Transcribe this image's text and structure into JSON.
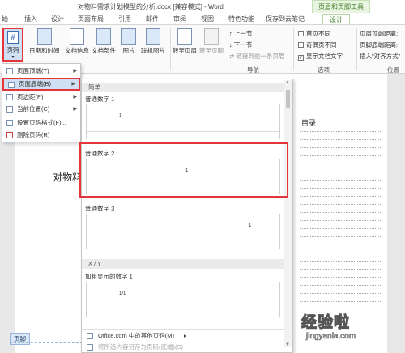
{
  "window": {
    "title": "对物料需求计划模型的分析.docx [兼容模式] - Word"
  },
  "contextual_tab_group": {
    "label": "页眉和页脚工具"
  },
  "tabs": [
    "始",
    "插入",
    "设计",
    "页面布局",
    "引用",
    "邮件",
    "审阅",
    "视图",
    "特色功能",
    "保存到云笔记",
    "设计"
  ],
  "ribbon": {
    "page_number": {
      "label": "页码",
      "icon": "#"
    },
    "buttons": [
      "日期和时间",
      "文档信息",
      "文档部件",
      "图片",
      "联机图片",
      "转至页眉",
      "转至页脚"
    ],
    "nav": {
      "prev": "上一节",
      "next": "下一节",
      "link_prev": "链接到前一条页眉",
      "group_label": "导航"
    },
    "options": {
      "first_page": "首页不同",
      "odd_even": "奇偶页不同",
      "show_text": "显示文档文字",
      "group_label": "选项"
    },
    "position": {
      "header_top": "页眉顶端距离:",
      "footer_bottom": "页脚底端距离:",
      "insert_align": "插入\"对齐方式\"",
      "group_label": "位置"
    }
  },
  "menu": {
    "items": [
      {
        "label": "页面顶端(T)",
        "has_sub": true
      },
      {
        "label": "页面底端(B)",
        "has_sub": true
      },
      {
        "label": "页边距(P)",
        "has_sub": true
      },
      {
        "label": "当前位置(C)",
        "has_sub": true
      },
      {
        "label": "设置页码格式(F)...",
        "has_sub": false
      },
      {
        "label": "删除页码(R)",
        "has_sub": false
      }
    ]
  },
  "gallery": {
    "section_simple": "简单",
    "items": [
      {
        "label": "普通数字 1"
      },
      {
        "label": "普通数字 2"
      },
      {
        "label": "普通数字 3"
      }
    ],
    "section_xy": "X / Y",
    "item_bold": "加粗显示的数字 1",
    "footer_more": "Office.com 中的其他页码(M)",
    "footer_save": "将所选内容另存为页码(底端)(S)"
  },
  "document": {
    "heading": "对物料",
    "toc_title": "目录.",
    "footer_tag": "页脚"
  },
  "watermark": {
    "main": "经验啦",
    "sub": "jingyanla.com",
    "check": "✓"
  },
  "colors": {
    "highlight": "#e3353a",
    "context_green": "#3e7e28",
    "selection_blue": "#cfe0f4"
  }
}
